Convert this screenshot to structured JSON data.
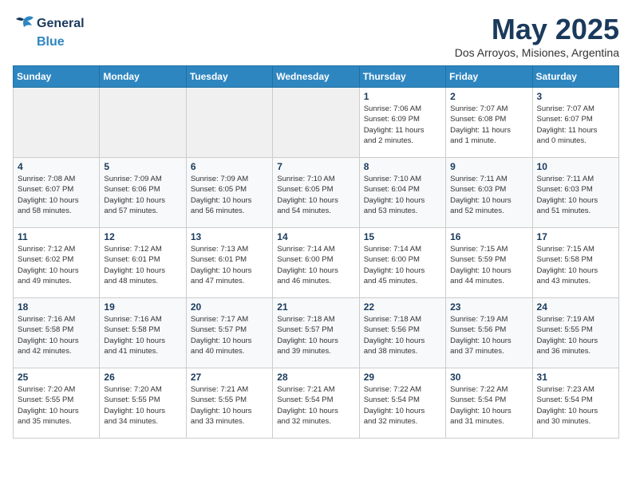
{
  "logo": {
    "line1": "General",
    "line2": "Blue"
  },
  "title": "May 2025",
  "subtitle": "Dos Arroyos, Misiones, Argentina",
  "weekdays": [
    "Sunday",
    "Monday",
    "Tuesday",
    "Wednesday",
    "Thursday",
    "Friday",
    "Saturday"
  ],
  "weeks": [
    [
      {
        "day": "",
        "info": ""
      },
      {
        "day": "",
        "info": ""
      },
      {
        "day": "",
        "info": ""
      },
      {
        "day": "",
        "info": ""
      },
      {
        "day": "1",
        "info": "Sunrise: 7:06 AM\nSunset: 6:09 PM\nDaylight: 11 hours\nand 2 minutes."
      },
      {
        "day": "2",
        "info": "Sunrise: 7:07 AM\nSunset: 6:08 PM\nDaylight: 11 hours\nand 1 minute."
      },
      {
        "day": "3",
        "info": "Sunrise: 7:07 AM\nSunset: 6:07 PM\nDaylight: 11 hours\nand 0 minutes."
      }
    ],
    [
      {
        "day": "4",
        "info": "Sunrise: 7:08 AM\nSunset: 6:07 PM\nDaylight: 10 hours\nand 58 minutes."
      },
      {
        "day": "5",
        "info": "Sunrise: 7:09 AM\nSunset: 6:06 PM\nDaylight: 10 hours\nand 57 minutes."
      },
      {
        "day": "6",
        "info": "Sunrise: 7:09 AM\nSunset: 6:05 PM\nDaylight: 10 hours\nand 56 minutes."
      },
      {
        "day": "7",
        "info": "Sunrise: 7:10 AM\nSunset: 6:05 PM\nDaylight: 10 hours\nand 54 minutes."
      },
      {
        "day": "8",
        "info": "Sunrise: 7:10 AM\nSunset: 6:04 PM\nDaylight: 10 hours\nand 53 minutes."
      },
      {
        "day": "9",
        "info": "Sunrise: 7:11 AM\nSunset: 6:03 PM\nDaylight: 10 hours\nand 52 minutes."
      },
      {
        "day": "10",
        "info": "Sunrise: 7:11 AM\nSunset: 6:03 PM\nDaylight: 10 hours\nand 51 minutes."
      }
    ],
    [
      {
        "day": "11",
        "info": "Sunrise: 7:12 AM\nSunset: 6:02 PM\nDaylight: 10 hours\nand 49 minutes."
      },
      {
        "day": "12",
        "info": "Sunrise: 7:12 AM\nSunset: 6:01 PM\nDaylight: 10 hours\nand 48 minutes."
      },
      {
        "day": "13",
        "info": "Sunrise: 7:13 AM\nSunset: 6:01 PM\nDaylight: 10 hours\nand 47 minutes."
      },
      {
        "day": "14",
        "info": "Sunrise: 7:14 AM\nSunset: 6:00 PM\nDaylight: 10 hours\nand 46 minutes."
      },
      {
        "day": "15",
        "info": "Sunrise: 7:14 AM\nSunset: 6:00 PM\nDaylight: 10 hours\nand 45 minutes."
      },
      {
        "day": "16",
        "info": "Sunrise: 7:15 AM\nSunset: 5:59 PM\nDaylight: 10 hours\nand 44 minutes."
      },
      {
        "day": "17",
        "info": "Sunrise: 7:15 AM\nSunset: 5:58 PM\nDaylight: 10 hours\nand 43 minutes."
      }
    ],
    [
      {
        "day": "18",
        "info": "Sunrise: 7:16 AM\nSunset: 5:58 PM\nDaylight: 10 hours\nand 42 minutes."
      },
      {
        "day": "19",
        "info": "Sunrise: 7:16 AM\nSunset: 5:58 PM\nDaylight: 10 hours\nand 41 minutes."
      },
      {
        "day": "20",
        "info": "Sunrise: 7:17 AM\nSunset: 5:57 PM\nDaylight: 10 hours\nand 40 minutes."
      },
      {
        "day": "21",
        "info": "Sunrise: 7:18 AM\nSunset: 5:57 PM\nDaylight: 10 hours\nand 39 minutes."
      },
      {
        "day": "22",
        "info": "Sunrise: 7:18 AM\nSunset: 5:56 PM\nDaylight: 10 hours\nand 38 minutes."
      },
      {
        "day": "23",
        "info": "Sunrise: 7:19 AM\nSunset: 5:56 PM\nDaylight: 10 hours\nand 37 minutes."
      },
      {
        "day": "24",
        "info": "Sunrise: 7:19 AM\nSunset: 5:55 PM\nDaylight: 10 hours\nand 36 minutes."
      }
    ],
    [
      {
        "day": "25",
        "info": "Sunrise: 7:20 AM\nSunset: 5:55 PM\nDaylight: 10 hours\nand 35 minutes."
      },
      {
        "day": "26",
        "info": "Sunrise: 7:20 AM\nSunset: 5:55 PM\nDaylight: 10 hours\nand 34 minutes."
      },
      {
        "day": "27",
        "info": "Sunrise: 7:21 AM\nSunset: 5:55 PM\nDaylight: 10 hours\nand 33 minutes."
      },
      {
        "day": "28",
        "info": "Sunrise: 7:21 AM\nSunset: 5:54 PM\nDaylight: 10 hours\nand 32 minutes."
      },
      {
        "day": "29",
        "info": "Sunrise: 7:22 AM\nSunset: 5:54 PM\nDaylight: 10 hours\nand 32 minutes."
      },
      {
        "day": "30",
        "info": "Sunrise: 7:22 AM\nSunset: 5:54 PM\nDaylight: 10 hours\nand 31 minutes."
      },
      {
        "day": "31",
        "info": "Sunrise: 7:23 AM\nSunset: 5:54 PM\nDaylight: 10 hours\nand 30 minutes."
      }
    ]
  ]
}
